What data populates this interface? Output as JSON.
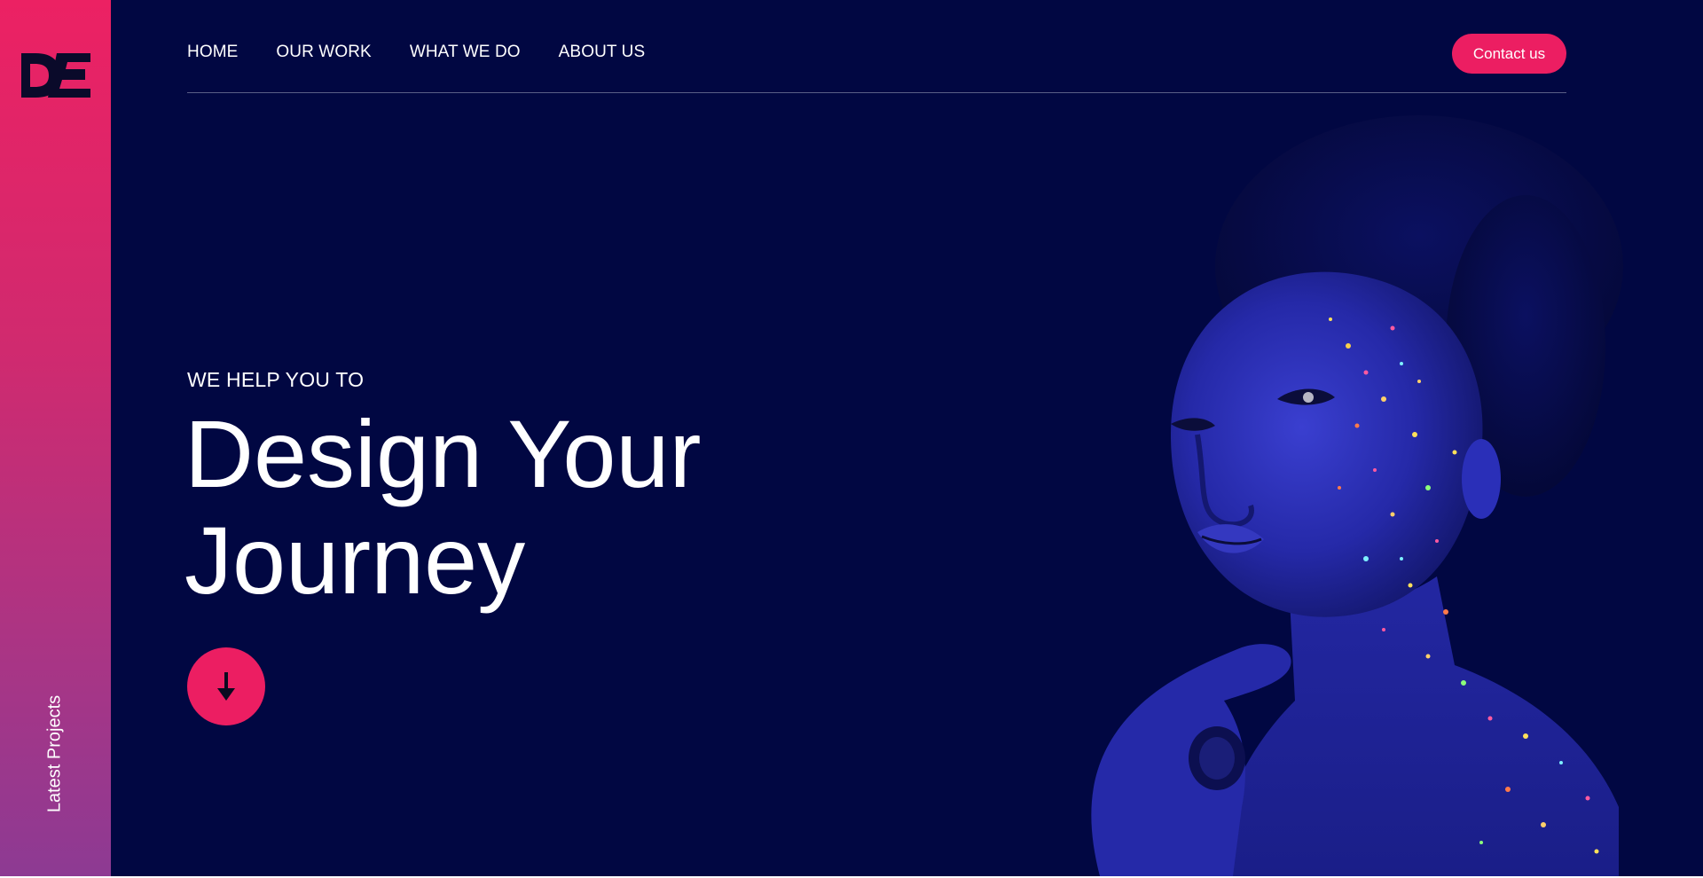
{
  "brand": {
    "logo_text": "DE",
    "accent_color": "#ec1e62",
    "background_color": "#010742"
  },
  "nav": {
    "items": [
      {
        "label": "HOME"
      },
      {
        "label": "OUR WORK"
      },
      {
        "label": "WHAT WE DO"
      },
      {
        "label": "ABOUT US"
      }
    ],
    "contact_label": "Contact us"
  },
  "sidebar": {
    "latest_projects_label": "Latest Projects"
  },
  "hero": {
    "eyebrow": "WE HELP YOU TO",
    "title_line1": "Design Your",
    "title_line2": "Journey",
    "scroll_icon": "arrow-down-icon",
    "image": "portrait of woman with glowing paint speckles"
  }
}
